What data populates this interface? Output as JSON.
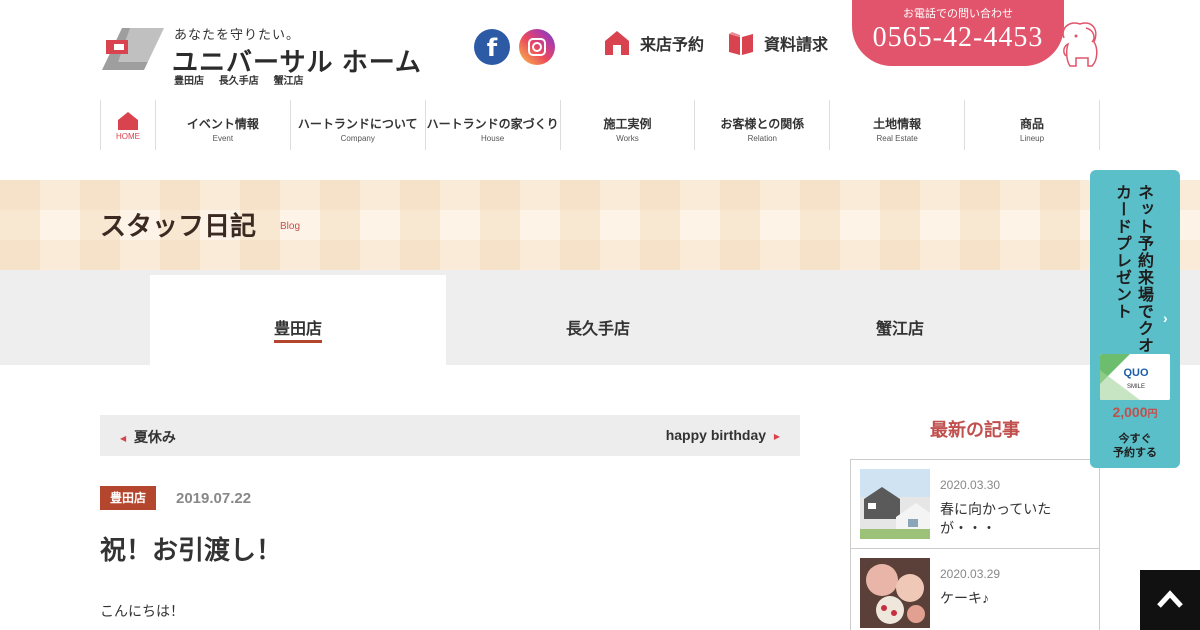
{
  "header": {
    "tagline": "あなたを守りたい。",
    "company_name": "ユニバーサル ホーム",
    "stores": [
      "豊田店",
      "長久手店",
      "蟹江店"
    ],
    "visit_label": "来店予約",
    "request_label": "資料請求",
    "tel_label": "お電話での問い合わせ",
    "tel_number": "0565-42-4453",
    "facebook_glyph": "f"
  },
  "nav": {
    "home": "HOME",
    "items": [
      {
        "jp": "イベント情報",
        "en": "Event"
      },
      {
        "jp": "ハートランドについて",
        "en": "Company"
      },
      {
        "jp": "ハートランドの家づくり",
        "en": "House"
      },
      {
        "jp": "施工実例",
        "en": "Works"
      },
      {
        "jp": "お客様との関係",
        "en": "Relation"
      },
      {
        "jp": "土地情報",
        "en": "Real Estate"
      },
      {
        "jp": "商品",
        "en": "Lineup"
      }
    ]
  },
  "page": {
    "title": "スタッフ日記",
    "title_en": "Blog"
  },
  "tabs": [
    {
      "label": "豊田店",
      "active": true
    },
    {
      "label": "長久手店",
      "active": false
    },
    {
      "label": "蟹江店",
      "active": false
    }
  ],
  "post_nav": {
    "prev": "夏休み",
    "next": "happy birthday"
  },
  "post": {
    "category": "豊田店",
    "date": "2019.07.22",
    "title": "祝！お引渡し！",
    "body_first": "こんにちは！"
  },
  "sidebar": {
    "heading": "最新の記事",
    "items": [
      {
        "date": "2020.03.30",
        "title": "春に向かっていたが・・・"
      },
      {
        "date": "2020.03.29",
        "title": "ケーキ♪"
      }
    ]
  },
  "campaign": {
    "text": "ネット予約来場でクオカードプレゼント",
    "card_brand": "QUO",
    "card_sub": "SMILE",
    "price": "2,000",
    "price_unit": "円",
    "cta_line1": "今すぐ",
    "cta_line2": "予約する"
  },
  "colors": {
    "accent": "#d9424f",
    "brand_brown": "#b5462e",
    "tel_pink": "#e2546b",
    "campaign_teal": "#5bbfc9"
  }
}
